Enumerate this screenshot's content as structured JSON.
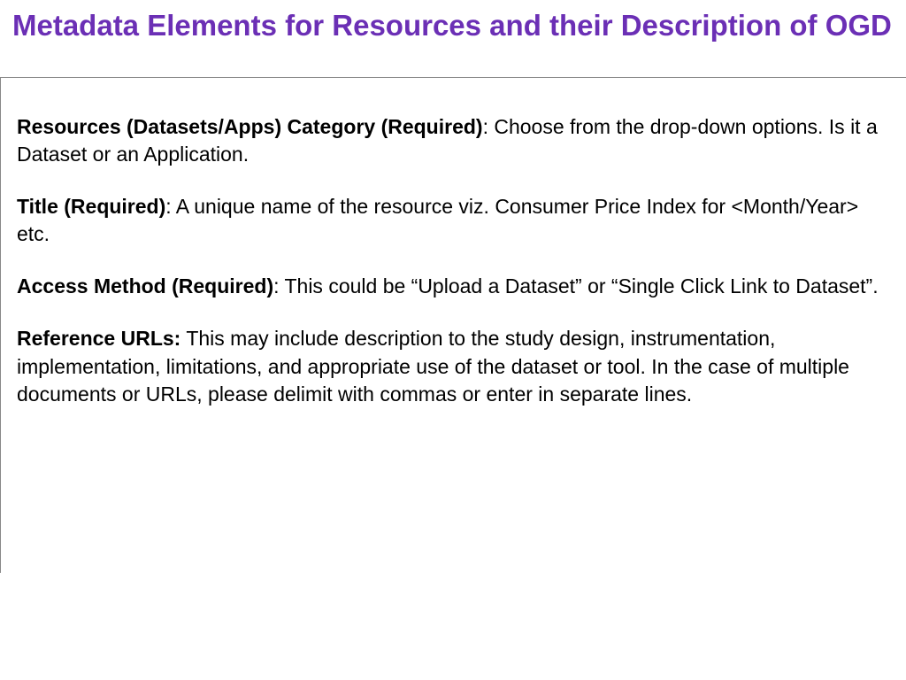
{
  "title": "Metadata Elements for Resources and their Description of OGD",
  "items": [
    {
      "label": "Resources (Datasets/Apps) Category (Required)",
      "desc": ": Choose from the drop-down options. Is it a Dataset or an Application."
    },
    {
      "label": "Title (Required)",
      "desc": ": A unique name of the resource viz. Consumer Price Index for <Month/Year> etc."
    },
    {
      "label": "Access Method (Required)",
      "desc": ": This could be “Upload a Dataset” or “Single Click Link to Dataset”."
    },
    {
      "label": "Reference URLs:",
      "desc": " This may include description to the study design, instrumentation, implementation, limitations, and appropriate use of the dataset or tool. In the case of multiple documents or URLs, please delimit with commas or enter in separate lines."
    }
  ]
}
